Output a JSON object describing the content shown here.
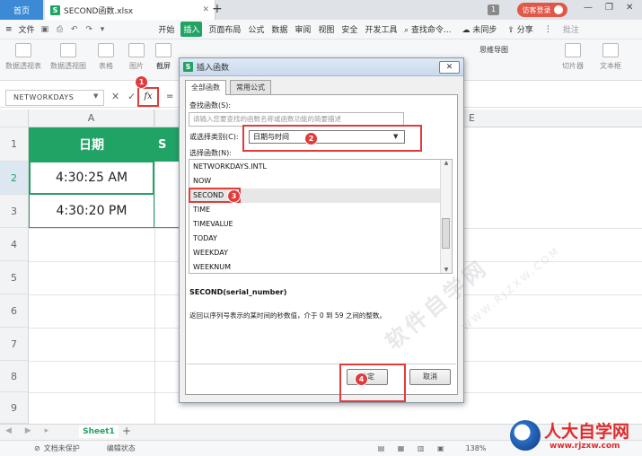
{
  "tabs": {
    "home": "首页",
    "file": "SECOND函数.xlsx",
    "plus": "+"
  },
  "topbar": {
    "badge": "1",
    "login": "访客登录"
  },
  "menu": {
    "items": [
      "文件",
      "开始",
      "插入",
      "页面布局",
      "公式",
      "数据",
      "审阅",
      "视图",
      "安全",
      "开发工具"
    ],
    "search": "查找命令...",
    "sync": "未同步",
    "share": "分享",
    "annotate": "批注"
  },
  "ribbon": {
    "items": [
      "数据透视表",
      "数据透视图",
      "表格",
      "图片",
      "截屏",
      "思维导图",
      "切片器",
      "文本框"
    ]
  },
  "formula_bar": {
    "name_box": "NETWORKDAYS",
    "fx": "fx",
    "eq": "=",
    "cancel": "✕",
    "confirm": "✓"
  },
  "sheet": {
    "col_a": "A",
    "col_e": "E",
    "row_numbers": [
      "1",
      "2",
      "3",
      "4",
      "5",
      "6",
      "7",
      "8",
      "9",
      "10"
    ],
    "header_date": "日期",
    "header_b": "S",
    "values": [
      "4:30:25 AM",
      "4:30:20 PM"
    ],
    "sheet_tab": "Sheet1"
  },
  "status": {
    "protect": "文档未保护",
    "edit": "编辑状态",
    "zoom": "138%"
  },
  "dialog": {
    "title": "插入函数",
    "close": "✕",
    "tab_all": "全部函数",
    "tab_common": "常用公式",
    "search_label": "查找函数(S):",
    "search_placeholder": "请输入您要查找的函数名称或函数功能的简要描述",
    "category_label": "或选择类别(C):",
    "category_value": "日期与时间",
    "select_label": "选择函数(N):",
    "functions": [
      "NETWORKDAYS.INTL",
      "NOW",
      "SECOND",
      "TIME",
      "TIMEVALUE",
      "TODAY",
      "WEEKDAY",
      "WEEKNUM"
    ],
    "selected_function": "SECOND",
    "signature": "SECOND(serial_number)",
    "description": "返回以序列号表示的某时间的秒数值，介于 0 到 59 之间的整数。",
    "ok": "确定",
    "cancel": "取消"
  },
  "markers": [
    "1",
    "2",
    "3",
    "4"
  ],
  "watermark": {
    "main": "软件自学网",
    "sub": "WWW.RJZXW.COM"
  },
  "logo": {
    "text": "大自学网",
    "url": "www.rjzxw.com"
  },
  "colors": {
    "accent": "#21a366",
    "highlight": "#e23b3b",
    "tab_blue": "#3c8ad6"
  }
}
